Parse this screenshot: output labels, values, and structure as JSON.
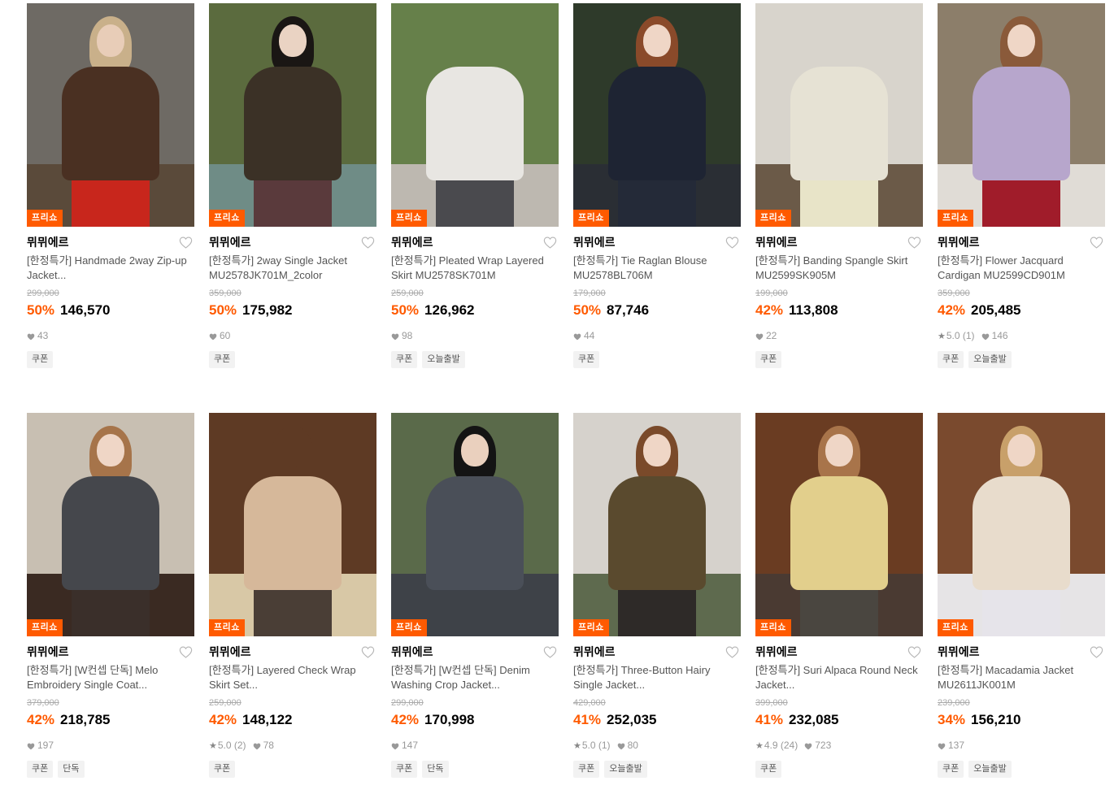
{
  "badge_label": "프리쇼",
  "colors": {
    "accent": "#ff5a00",
    "brand_text": "#000000",
    "strike": "#aaaaaa"
  },
  "products": [
    {
      "brand": "뮈뮈에르",
      "title": "[한정특가] Handmade 2way Zip-up Jacket...",
      "original_price": "299,000",
      "discount": "50%",
      "price": "146,570",
      "rating": "",
      "likes": "43",
      "tags": [
        "쿠폰"
      ],
      "palette": {
        "bg": "#6e6a64",
        "floor": "#5a4a3a",
        "hair": "#c9b08a",
        "skin": "#e8cdb8",
        "body": "#4a3022",
        "lower": "#c8261c",
        "legs": "#3c2a1e"
      }
    },
    {
      "brand": "뮈뮈에르",
      "title": "[한정특가] 2way Single Jacket MU2578JK701M_2color",
      "original_price": "359,000",
      "discount": "50%",
      "price": "175,982",
      "rating": "",
      "likes": "60",
      "tags": [
        "쿠폰"
      ],
      "palette": {
        "bg": "#5b6b3e",
        "floor": "#6f8c86",
        "hair": "#1a1614",
        "skin": "#ead3c3",
        "body": "#3b3126",
        "lower": "#5a3a3c",
        "legs": "#e9d7c9"
      }
    },
    {
      "brand": "뮈뮈에르",
      "title": "[한정특가] Pleated Wrap Layered Skirt MU2578SK701M",
      "original_price": "259,000",
      "discount": "50%",
      "price": "126,962",
      "rating": "",
      "likes": "98",
      "tags": [
        "쿠폰",
        "오늘출발"
      ],
      "palette": {
        "bg": "#66804a",
        "floor": "#bdb8b0",
        "hair": "#66804a",
        "skin": "#66804a",
        "body": "#e8e6e2",
        "lower": "#4a4a4e",
        "legs": "#1c1c1c"
      }
    },
    {
      "brand": "뮈뮈에르",
      "title": "[한정특가] Tie Raglan Blouse MU2578BL706M",
      "original_price": "179,000",
      "discount": "50%",
      "price": "87,746",
      "rating": "",
      "likes": "44",
      "tags": [
        "쿠폰"
      ],
      "palette": {
        "bg": "#2e3a2a",
        "floor": "#2a2e34",
        "hair": "#8a4a2a",
        "skin": "#efd6c6",
        "body": "#1e2433",
        "lower": "#242a38",
        "legs": "#242a38"
      }
    },
    {
      "brand": "뮈뮈에르",
      "title": "[한정특가] Banding Spangle Skirt MU2599SK905M",
      "original_price": "199,000",
      "discount": "42%",
      "price": "113,808",
      "rating": "",
      "likes": "22",
      "tags": [
        "쿠폰"
      ],
      "palette": {
        "bg": "#d8d4cc",
        "floor": "#6b5a48",
        "hair": "#d8d4cc",
        "skin": "#d8d4cc",
        "body": "#e6e2d4",
        "lower": "#e8e4c8",
        "legs": "#c6d2dc"
      }
    },
    {
      "brand": "뮈뮈에르",
      "title": "[한정특가] Flower Jacquard Cardigan MU2599CD901M",
      "original_price": "359,000",
      "discount": "42%",
      "price": "205,485",
      "rating": "5.0 (1)",
      "likes": "146",
      "tags": [
        "쿠폰",
        "오늘출발"
      ],
      "palette": {
        "bg": "#8c7e6a",
        "floor": "#e0dcd6",
        "hair": "#8a5a3a",
        "skin": "#efd6c6",
        "body": "#b7a6cc",
        "lower": "#a01c2a",
        "legs": "#ece6de"
      }
    },
    {
      "brand": "뮈뮈에르",
      "title": "[한정특가] [W컨셉 단독] Melo Embroidery Single Coat...",
      "original_price": "379,000",
      "discount": "42%",
      "price": "218,785",
      "rating": "",
      "likes": "197",
      "tags": [
        "쿠폰",
        "단독"
      ],
      "palette": {
        "bg": "#c8bfb2",
        "floor": "#3a2a22",
        "hair": "#a6744a",
        "skin": "#efd6c6",
        "body": "#45474c",
        "lower": "#3a2f2a",
        "legs": "#5a4a40"
      }
    },
    {
      "brand": "뮈뮈에르",
      "title": "[한정특가] Layered Check Wrap Skirt Set...",
      "original_price": "259,000",
      "discount": "42%",
      "price": "148,122",
      "rating": "5.0 (2)",
      "likes": "78",
      "tags": [
        "쿠폰"
      ],
      "palette": {
        "bg": "#5e3a24",
        "floor": "#d8c8a6",
        "hair": "#5e3a24",
        "skin": "#5e3a24",
        "body": "#d6b89a",
        "lower": "#4a3e36",
        "legs": "#2a2624"
      }
    },
    {
      "brand": "뮈뮈에르",
      "title": "[한정특가] [W컨셉 단독] Denim Washing Crop Jacket...",
      "original_price": "299,000",
      "discount": "42%",
      "price": "170,998",
      "rating": "",
      "likes": "147",
      "tags": [
        "쿠폰",
        "단독"
      ],
      "palette": {
        "bg": "#5a6a4a",
        "floor": "#3e4248",
        "hair": "#141414",
        "skin": "#ead0be",
        "body": "#4a4f58",
        "lower": "#3e4248",
        "legs": "#3e4248"
      }
    },
    {
      "brand": "뮈뮈에르",
      "title": "[한정특가] Three-Button Hairy Single Jacket...",
      "original_price": "429,000",
      "discount": "41%",
      "price": "252,035",
      "rating": "5.0 (1)",
      "likes": "80",
      "tags": [
        "쿠폰",
        "오늘출발"
      ],
      "palette": {
        "bg": "#d6d2cc",
        "floor": "#5e6a4e",
        "hair": "#7a4a2a",
        "skin": "#efd6c6",
        "body": "#5a4a2e",
        "lower": "#2e2a28",
        "legs": "#b8a898"
      }
    },
    {
      "brand": "뮈뮈에르",
      "title": "[한정특가] Suri Alpaca Round Neck Jacket...",
      "original_price": "399,000",
      "discount": "41%",
      "price": "232,085",
      "rating": "4.9 (24)",
      "likes": "723",
      "tags": [
        "쿠폰"
      ],
      "palette": {
        "bg": "#6a3c22",
        "floor": "#4a3a32",
        "hair": "#a8744a",
        "skin": "#efd6c6",
        "body": "#e2cf8c",
        "lower": "#4a4640",
        "legs": "#3a3634"
      }
    },
    {
      "brand": "뮈뮈에르",
      "title": "[한정특가] Macadamia Jacket MU2611JK001M",
      "original_price": "239,000",
      "discount": "34%",
      "price": "156,210",
      "rating": "",
      "likes": "137",
      "tags": [
        "쿠폰",
        "오늘출발"
      ],
      "palette": {
        "bg": "#7a4a2e",
        "floor": "#e6e4e6",
        "hair": "#c8a06a",
        "skin": "#efd6c6",
        "body": "#e8dccc",
        "lower": "#e6e4ea",
        "legs": "#e6e4ea"
      }
    }
  ]
}
